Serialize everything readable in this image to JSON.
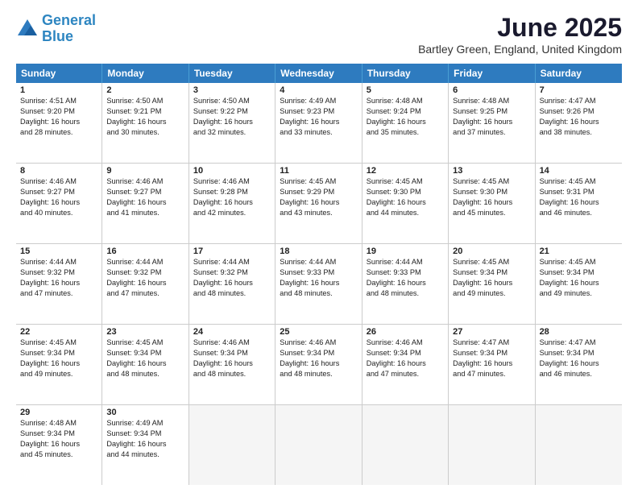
{
  "logo": {
    "line1": "General",
    "line2": "Blue"
  },
  "title": "June 2025",
  "subtitle": "Bartley Green, England, United Kingdom",
  "days": [
    "Sunday",
    "Monday",
    "Tuesday",
    "Wednesday",
    "Thursday",
    "Friday",
    "Saturday"
  ],
  "weeks": [
    [
      {
        "day": 1,
        "lines": [
          "Sunrise: 4:51 AM",
          "Sunset: 9:20 PM",
          "Daylight: 16 hours",
          "and 28 minutes."
        ]
      },
      {
        "day": 2,
        "lines": [
          "Sunrise: 4:50 AM",
          "Sunset: 9:21 PM",
          "Daylight: 16 hours",
          "and 30 minutes."
        ]
      },
      {
        "day": 3,
        "lines": [
          "Sunrise: 4:50 AM",
          "Sunset: 9:22 PM",
          "Daylight: 16 hours",
          "and 32 minutes."
        ]
      },
      {
        "day": 4,
        "lines": [
          "Sunrise: 4:49 AM",
          "Sunset: 9:23 PM",
          "Daylight: 16 hours",
          "and 33 minutes."
        ]
      },
      {
        "day": 5,
        "lines": [
          "Sunrise: 4:48 AM",
          "Sunset: 9:24 PM",
          "Daylight: 16 hours",
          "and 35 minutes."
        ]
      },
      {
        "day": 6,
        "lines": [
          "Sunrise: 4:48 AM",
          "Sunset: 9:25 PM",
          "Daylight: 16 hours",
          "and 37 minutes."
        ]
      },
      {
        "day": 7,
        "lines": [
          "Sunrise: 4:47 AM",
          "Sunset: 9:26 PM",
          "Daylight: 16 hours",
          "and 38 minutes."
        ]
      }
    ],
    [
      {
        "day": 8,
        "lines": [
          "Sunrise: 4:46 AM",
          "Sunset: 9:27 PM",
          "Daylight: 16 hours",
          "and 40 minutes."
        ]
      },
      {
        "day": 9,
        "lines": [
          "Sunrise: 4:46 AM",
          "Sunset: 9:27 PM",
          "Daylight: 16 hours",
          "and 41 minutes."
        ]
      },
      {
        "day": 10,
        "lines": [
          "Sunrise: 4:46 AM",
          "Sunset: 9:28 PM",
          "Daylight: 16 hours",
          "and 42 minutes."
        ]
      },
      {
        "day": 11,
        "lines": [
          "Sunrise: 4:45 AM",
          "Sunset: 9:29 PM",
          "Daylight: 16 hours",
          "and 43 minutes."
        ]
      },
      {
        "day": 12,
        "lines": [
          "Sunrise: 4:45 AM",
          "Sunset: 9:30 PM",
          "Daylight: 16 hours",
          "and 44 minutes."
        ]
      },
      {
        "day": 13,
        "lines": [
          "Sunrise: 4:45 AM",
          "Sunset: 9:30 PM",
          "Daylight: 16 hours",
          "and 45 minutes."
        ]
      },
      {
        "day": 14,
        "lines": [
          "Sunrise: 4:45 AM",
          "Sunset: 9:31 PM",
          "Daylight: 16 hours",
          "and 46 minutes."
        ]
      }
    ],
    [
      {
        "day": 15,
        "lines": [
          "Sunrise: 4:44 AM",
          "Sunset: 9:32 PM",
          "Daylight: 16 hours",
          "and 47 minutes."
        ]
      },
      {
        "day": 16,
        "lines": [
          "Sunrise: 4:44 AM",
          "Sunset: 9:32 PM",
          "Daylight: 16 hours",
          "and 47 minutes."
        ]
      },
      {
        "day": 17,
        "lines": [
          "Sunrise: 4:44 AM",
          "Sunset: 9:32 PM",
          "Daylight: 16 hours",
          "and 48 minutes."
        ]
      },
      {
        "day": 18,
        "lines": [
          "Sunrise: 4:44 AM",
          "Sunset: 9:33 PM",
          "Daylight: 16 hours",
          "and 48 minutes."
        ]
      },
      {
        "day": 19,
        "lines": [
          "Sunrise: 4:44 AM",
          "Sunset: 9:33 PM",
          "Daylight: 16 hours",
          "and 48 minutes."
        ]
      },
      {
        "day": 20,
        "lines": [
          "Sunrise: 4:45 AM",
          "Sunset: 9:34 PM",
          "Daylight: 16 hours",
          "and 49 minutes."
        ]
      },
      {
        "day": 21,
        "lines": [
          "Sunrise: 4:45 AM",
          "Sunset: 9:34 PM",
          "Daylight: 16 hours",
          "and 49 minutes."
        ]
      }
    ],
    [
      {
        "day": 22,
        "lines": [
          "Sunrise: 4:45 AM",
          "Sunset: 9:34 PM",
          "Daylight: 16 hours",
          "and 49 minutes."
        ]
      },
      {
        "day": 23,
        "lines": [
          "Sunrise: 4:45 AM",
          "Sunset: 9:34 PM",
          "Daylight: 16 hours",
          "and 48 minutes."
        ]
      },
      {
        "day": 24,
        "lines": [
          "Sunrise: 4:46 AM",
          "Sunset: 9:34 PM",
          "Daylight: 16 hours",
          "and 48 minutes."
        ]
      },
      {
        "day": 25,
        "lines": [
          "Sunrise: 4:46 AM",
          "Sunset: 9:34 PM",
          "Daylight: 16 hours",
          "and 48 minutes."
        ]
      },
      {
        "day": 26,
        "lines": [
          "Sunrise: 4:46 AM",
          "Sunset: 9:34 PM",
          "Daylight: 16 hours",
          "and 47 minutes."
        ]
      },
      {
        "day": 27,
        "lines": [
          "Sunrise: 4:47 AM",
          "Sunset: 9:34 PM",
          "Daylight: 16 hours",
          "and 47 minutes."
        ]
      },
      {
        "day": 28,
        "lines": [
          "Sunrise: 4:47 AM",
          "Sunset: 9:34 PM",
          "Daylight: 16 hours",
          "and 46 minutes."
        ]
      }
    ],
    [
      {
        "day": 29,
        "lines": [
          "Sunrise: 4:48 AM",
          "Sunset: 9:34 PM",
          "Daylight: 16 hours",
          "and 45 minutes."
        ]
      },
      {
        "day": 30,
        "lines": [
          "Sunrise: 4:49 AM",
          "Sunset: 9:34 PM",
          "Daylight: 16 hours",
          "and 44 minutes."
        ]
      },
      null,
      null,
      null,
      null,
      null
    ]
  ]
}
